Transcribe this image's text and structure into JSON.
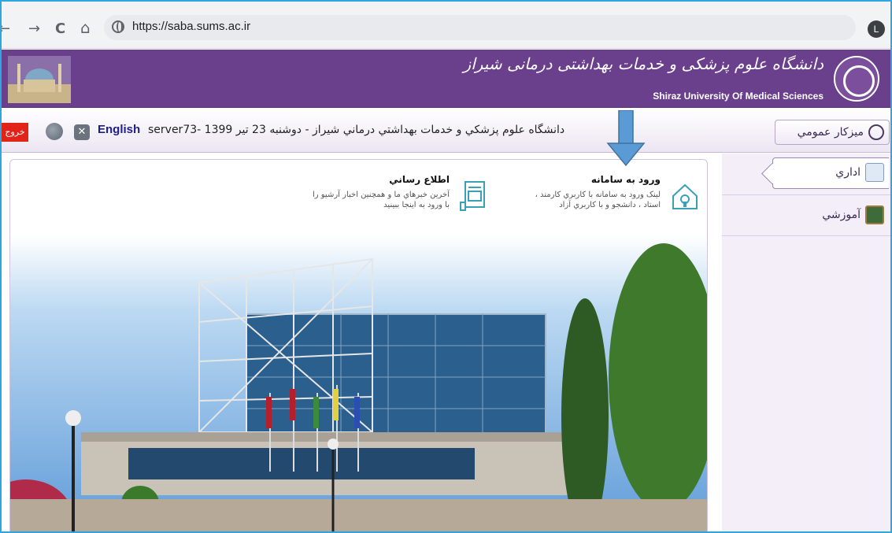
{
  "browser": {
    "back": "←",
    "forward": "→",
    "reload": "C",
    "home": "⌂",
    "url": "https://saba.sums.ac.ir",
    "profile_initial": "L"
  },
  "banner": {
    "title_fa": "دانشگاه علوم پزشکی و خدمات بهداشتی درمانی شیراز",
    "title_en": "Shiraz University Of Medical Sciences"
  },
  "toolbar": {
    "logout_label": "خروج",
    "english_label": "English",
    "status_text": "دانشگاه علوم پزشکي و خدمات بهداشتي درماني شيراز - دوشنبه 23 تير 1399 -server73",
    "desk_label": "ميزكار عمومي"
  },
  "sidebar": {
    "items": [
      {
        "label": "اداري",
        "active": true,
        "icon": "admin-icon"
      },
      {
        "label": "آموزشي",
        "active": false,
        "icon": "education-icon"
      }
    ]
  },
  "cards": [
    {
      "title": "ورود به سامانه",
      "description": "لينک ورود به سامانه با کاربري کارمند ، استاد ، دانشجو و با کاربري آزاد",
      "icon": "house-login-icon"
    },
    {
      "title": "اطلاع رساني",
      "description": "آخرين خبرهاي ما و همچنين اخبار آرشيو را با ورود به اينجا ببينيد",
      "icon": "news-document-icon"
    }
  ],
  "colors": {
    "banner": "#6a3f8c",
    "logout": "#e2231a",
    "english": "#1c1f8a",
    "arrow": "#5b9bd5"
  }
}
